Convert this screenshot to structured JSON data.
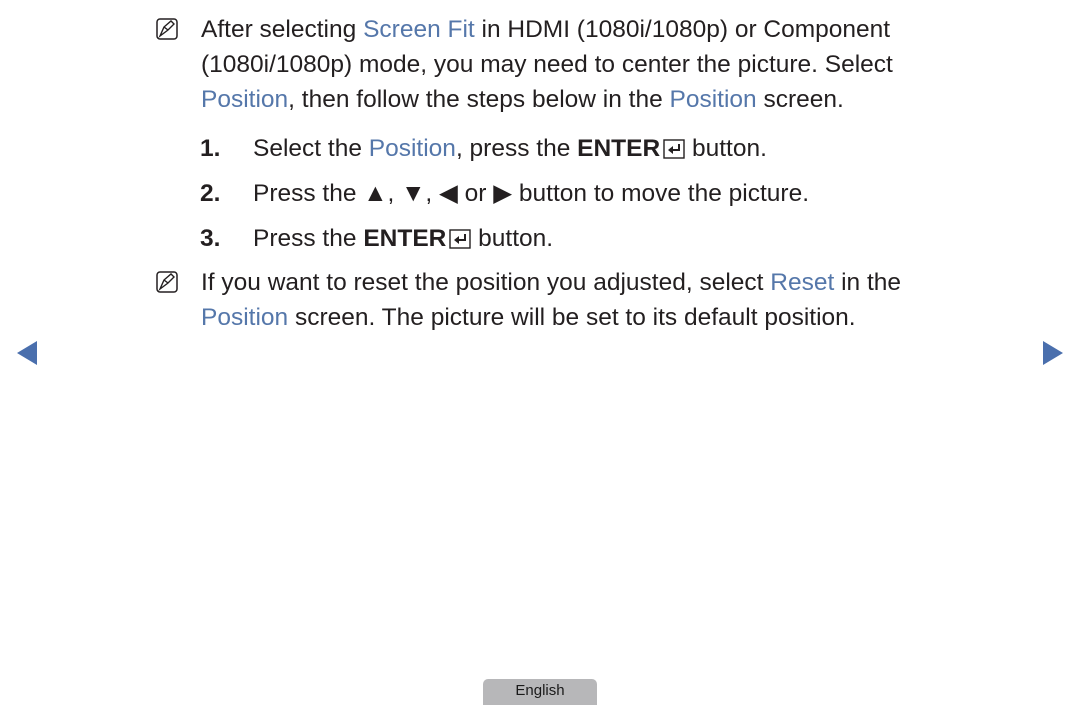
{
  "note1": {
    "icon": "note-icon",
    "lines": [
      [
        {
          "t": "After selecting "
        },
        {
          "t": "Screen Fit",
          "hl": true
        },
        {
          "t": " in HDMI (1080i/1080p) or Component"
        }
      ],
      [
        {
          "t": "(1080i/1080p) mode, you may need to center the picture. Select"
        }
      ],
      [
        {
          "t": "Position",
          "hl": true
        },
        {
          "t": ", then follow the steps below in the "
        },
        {
          "t": "Position",
          "hl": true
        },
        {
          "t": " screen."
        }
      ]
    ]
  },
  "steps": [
    {
      "num": "1.",
      "parts": [
        {
          "t": "Select the "
        },
        {
          "t": "Position",
          "hl": true
        },
        {
          "t": ", press the "
        },
        {
          "t": "ENTER",
          "b": true
        },
        {
          "icon": "enter"
        },
        {
          "t": " button."
        }
      ]
    },
    {
      "num": "2.",
      "parts": [
        {
          "t": "Press the ▲, ▼, ◀ or ▶ button to move the picture."
        }
      ]
    },
    {
      "num": "3.",
      "parts": [
        {
          "t": "Press the "
        },
        {
          "t": "ENTER",
          "b": true
        },
        {
          "icon": "enter"
        },
        {
          "t": " button."
        }
      ]
    }
  ],
  "note2": {
    "icon": "note-icon",
    "lines": [
      [
        {
          "t": "If you want to reset the position you adjusted, select "
        },
        {
          "t": "Reset",
          "hl": true
        },
        {
          "t": " in the"
        }
      ],
      [
        {
          "t": "Position",
          "hl": true
        },
        {
          "t": " screen. The picture will be set to its default position."
        }
      ]
    ]
  },
  "nav": {
    "prev_icon": "triangle-left-icon",
    "next_icon": "triangle-right-icon"
  },
  "footer": {
    "language": "English"
  },
  "colors": {
    "highlight": "#5577aa",
    "arrow": "#4a6fad",
    "tab": "#b7b7b9"
  }
}
